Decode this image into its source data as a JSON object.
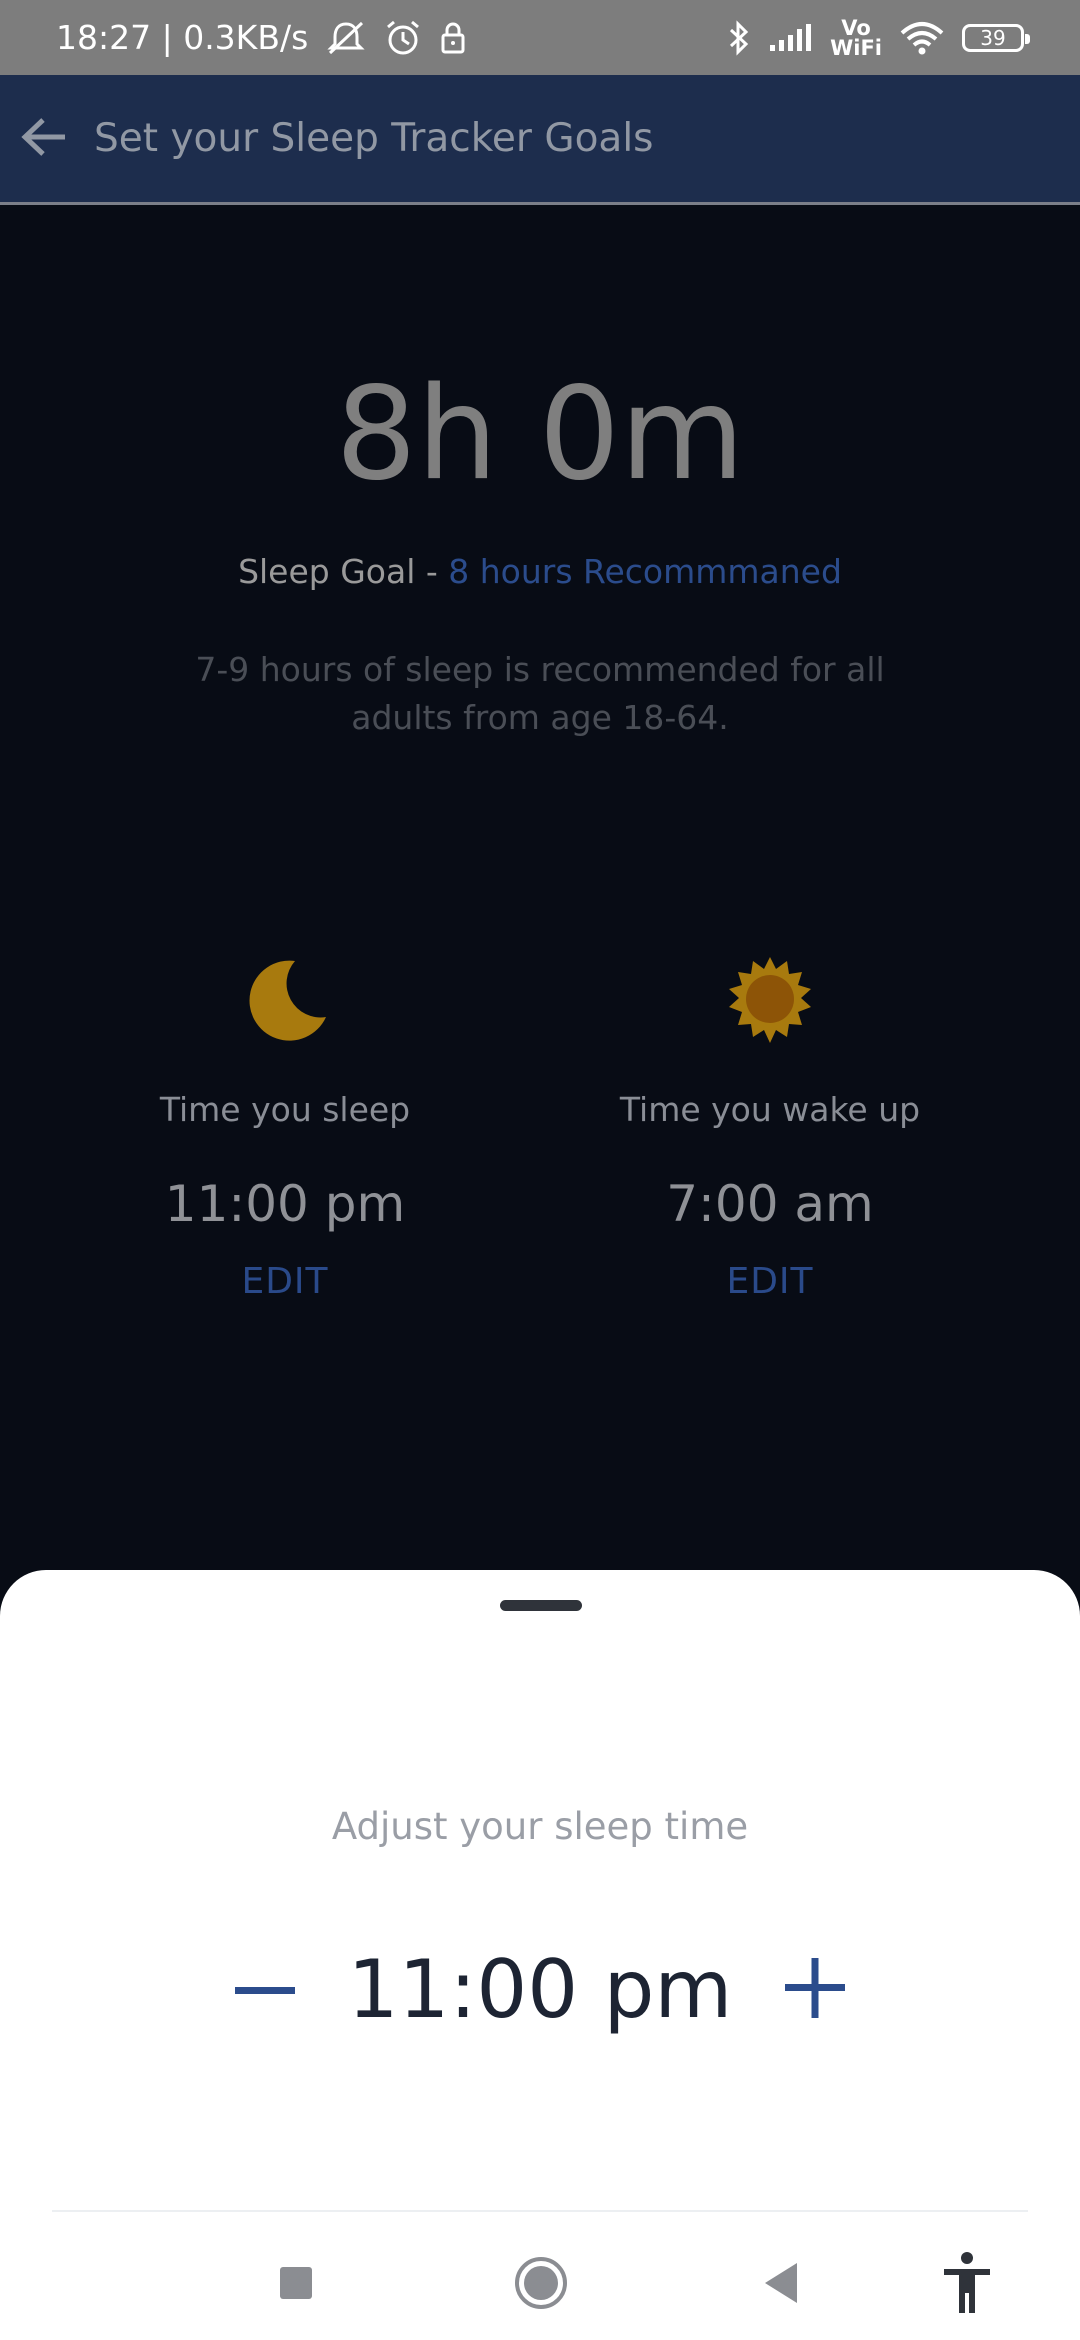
{
  "status_bar": {
    "time_speed": "18:27 | 0.3KB/s",
    "battery": "39",
    "icons": [
      "mute-icon",
      "alarm-icon",
      "lock-icon",
      "bluetooth-icon",
      "signal-icon",
      "vowifi-icon",
      "wifi-icon",
      "battery-icon"
    ],
    "vowifi_top": "Vo",
    "vowifi_bottom": "WiFi"
  },
  "appbar": {
    "title": "Set your Sleep Tracker Goals",
    "back_icon": "arrow-back-icon"
  },
  "summary": {
    "duration": "8h 0m",
    "goal_label": "Sleep Goal - ",
    "goal_recommendation": "8 hours Recommmaned",
    "description": "7-9 hours of sleep is recommended for all adults from age 18-64."
  },
  "sleep": {
    "icon": "moon-icon",
    "label": "Time you sleep",
    "time": "11:00 pm",
    "edit": "EDIT"
  },
  "wake": {
    "icon": "sun-icon",
    "label": "Time you wake up",
    "time": "7:00 am",
    "edit": "EDIT"
  },
  "sheet": {
    "title": "Adjust your sleep time",
    "value": "11:00 pm",
    "minus_icon": "minus-icon",
    "plus_icon": "plus-icon"
  },
  "nav": {
    "icons": [
      "recents-icon",
      "home-icon",
      "back-icon",
      "accessibility-icon"
    ]
  },
  "colors": {
    "appbar": "#1d2d4d",
    "accent": "#2b4c8c",
    "icon_gold": "#a87a0e"
  }
}
